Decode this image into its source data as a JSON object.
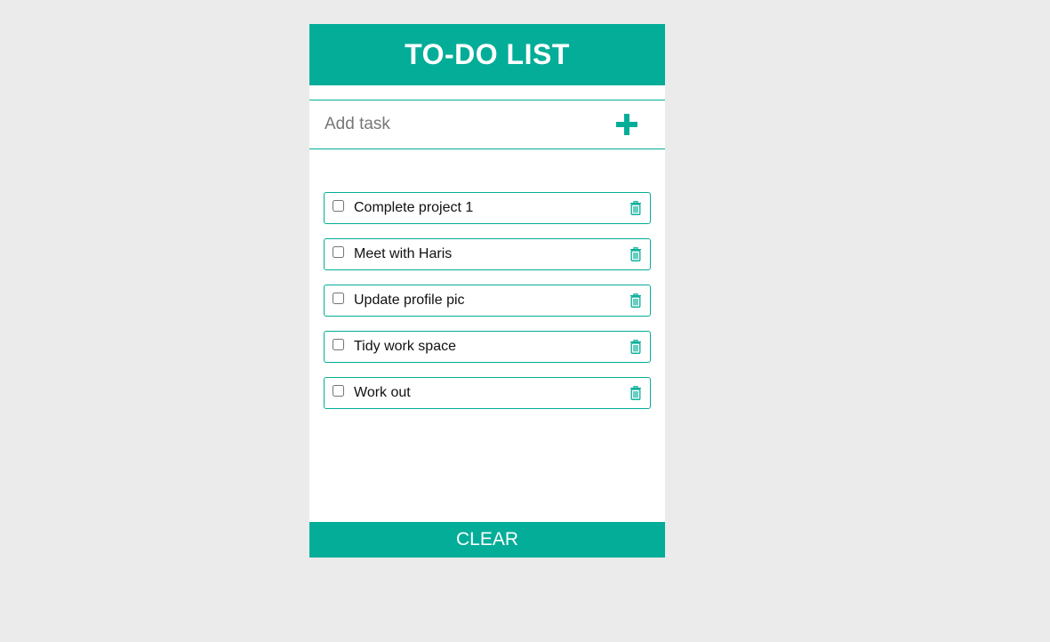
{
  "app": {
    "title": "TO-DO LIST",
    "accent_color": "#04ad98"
  },
  "add_task": {
    "placeholder": "Add task",
    "value": "",
    "button_icon": "plus-icon"
  },
  "tasks": [
    {
      "label": "Complete project 1",
      "checked": false,
      "delete_icon": "trash-icon"
    },
    {
      "label": "Meet with Haris",
      "checked": false,
      "delete_icon": "trash-icon"
    },
    {
      "label": "Update profile pic",
      "checked": false,
      "delete_icon": "trash-icon"
    },
    {
      "label": "Tidy work space",
      "checked": false,
      "delete_icon": "trash-icon"
    },
    {
      "label": "Work out",
      "checked": false,
      "delete_icon": "trash-icon"
    }
  ],
  "footer": {
    "clear_label": "CLEAR"
  }
}
